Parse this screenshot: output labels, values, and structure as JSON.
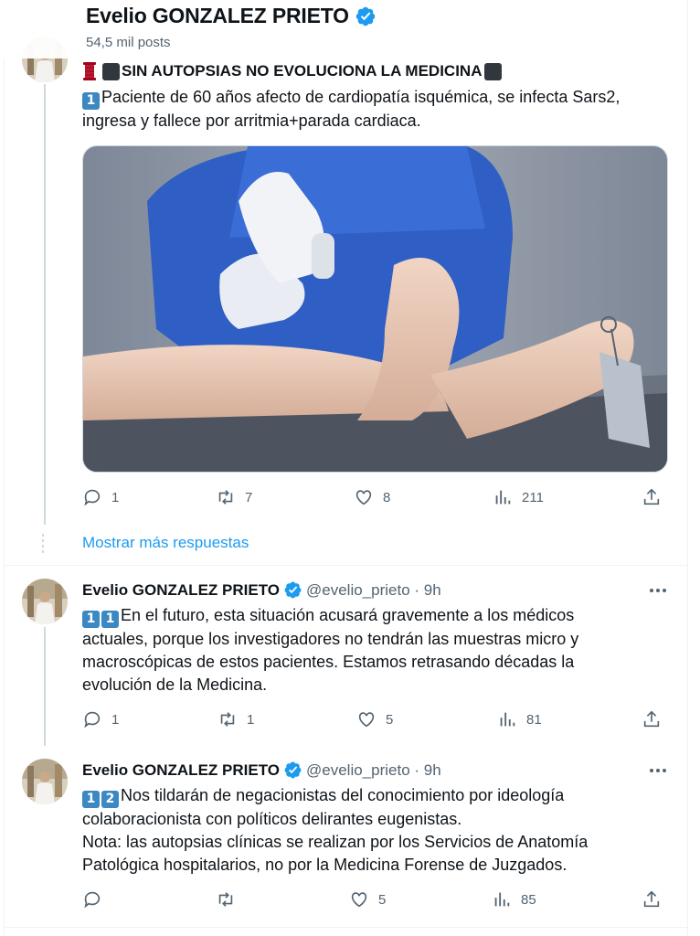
{
  "header": {
    "name": "Evelio GONZALEZ PRIETO",
    "post_count": "54,5 mil posts"
  },
  "main_tweet": {
    "title": "SIN AUTOPSIAS NO EVOLUCIONA LA MEDICINA",
    "number": "1",
    "body_line1": "Paciente de 60 años afecto de cardiopatía isquémica, se infecta Sars2,",
    "body_line2": "ingresa y fallece por arritmia+parada cardiaca.",
    "stats": {
      "replies": "1",
      "reposts": "7",
      "likes": "8",
      "views": "211"
    }
  },
  "show_more": "Mostrar más respuestas",
  "replies": [
    {
      "name": "Evelio GONZALEZ PRIETO",
      "meta": "@evelio_prieto · 9h",
      "num_a": "1",
      "num_b": "1",
      "line1": "En el futuro, esta situación acusará gravemente a los médicos",
      "line2": "actuales, porque los investigadores no tendrán las muestras micro y",
      "line3": "macroscópicas de estos pacientes. Estamos retrasando décadas la",
      "line4": "evolución de la Medicina.",
      "stats": {
        "replies": "1",
        "reposts": "1",
        "likes": "5",
        "views": "81"
      }
    },
    {
      "name": "Evelio GONZALEZ PRIETO",
      "meta": "@evelio_prieto · 9h",
      "num_a": "1",
      "num_b": "2",
      "line1": "Nos tildarán de negacionistas del conocimiento por ideología",
      "line2": "colaboracionista con políticos delirantes eugenistas.",
      "line3": "Nota: las autopsias clínicas se realizan por los Servicios de Anatomía",
      "line4": "Patológica hospitalarios, no por la Medicina Forense de Juzgados.",
      "stats": {
        "likes": "5",
        "views": "85"
      }
    }
  ],
  "colors": {
    "accent": "#1d9bf0",
    "muted": "#536471",
    "text": "#0f1419"
  },
  "icons": [
    "verified-badge-icon",
    "spool-emoji-icon",
    "black-square-icon",
    "keycap-number-icon",
    "reply-icon",
    "repost-icon",
    "like-icon",
    "views-icon",
    "share-icon",
    "more-icon"
  ]
}
